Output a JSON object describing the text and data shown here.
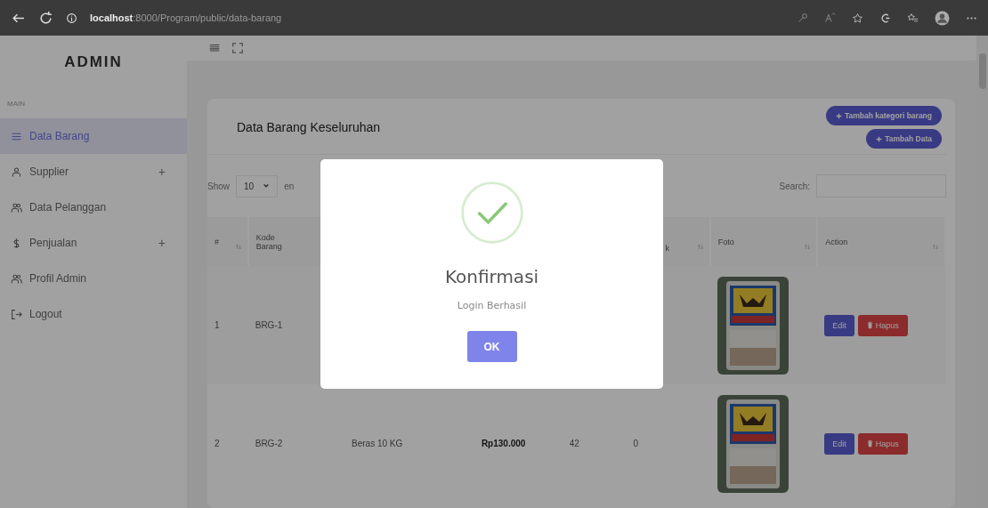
{
  "browser": {
    "url_host": "localhost",
    "url_path": ":8000/Program/public/data-barang"
  },
  "sidebar": {
    "brand": "ADMIN",
    "section": "MAIN",
    "items": [
      {
        "label": "Data Barang",
        "kind": "list",
        "selected": true
      },
      {
        "label": "Supplier",
        "kind": "user",
        "selected": false,
        "expand_mark": "+"
      },
      {
        "label": "Data Pelanggan",
        "kind": "users",
        "selected": false
      },
      {
        "label": "Penjualan",
        "kind": "dollar",
        "selected": false,
        "expand_mark": "+"
      },
      {
        "label": "Profil Admin",
        "kind": "users",
        "selected": false
      },
      {
        "label": "Logout",
        "kind": "logout",
        "selected": false
      }
    ]
  },
  "card": {
    "title": "Data Barang Keseluruhan",
    "buttons": [
      "Tambah kategori barang",
      "Tambah Data"
    ],
    "length": {
      "label": "Show",
      "value": "10",
      "suffix": "en"
    },
    "search": {
      "label": "Search:"
    },
    "table": {
      "columns": [
        {
          "label": "#"
        },
        {
          "label": "Kode Barang"
        },
        {},
        {},
        {},
        {
          "label": "k"
        },
        {
          "label": "Foto"
        },
        {
          "label": "Action"
        }
      ],
      "rows": [
        {
          "cells": [
            "1",
            "BRG-1"
          ],
          "edit": "Edit",
          "delete": "Hapus"
        },
        {
          "cells": [
            "2",
            "BRG-2",
            "Beras 10 KG",
            "Rp130.000",
            "42",
            "0"
          ],
          "edit": "Edit",
          "delete": "Hapus"
        }
      ]
    }
  },
  "modal": {
    "title": "Konfirmasi",
    "message": "Login Berhasil",
    "button": "OK"
  }
}
